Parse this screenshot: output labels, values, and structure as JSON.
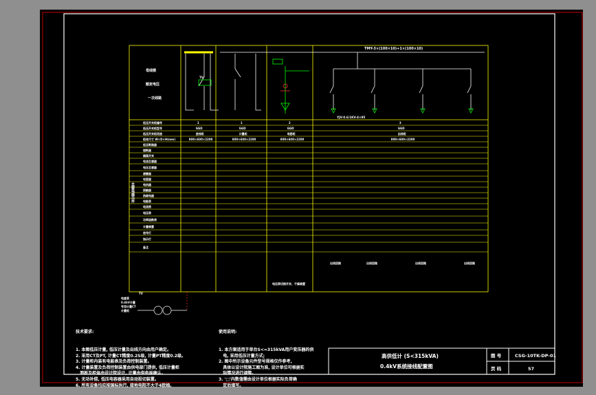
{
  "colors": {
    "frame": "#ffffff",
    "outer_frame": "#c00000",
    "grid": "#ffff00",
    "red": "#ff3030",
    "green": "#00ff00",
    "cyan": "#00ffff",
    "wire": "#ffffff"
  },
  "drawing": {
    "left_header": {
      "l1": "母线侧",
      "l2": "额定电压",
      "l3": "一次线路"
    },
    "busbar_label": "TMY-3×(100×10)+1×(100×10)",
    "feeder_cable": "YJV-0.6/1KV-4×95",
    "meter_labels": [
      "计量装置"
    ],
    "rows": [
      "低压开关柜编号",
      "低压开关柜型号",
      "低压开关柜用途",
      "柜体尺寸 W×D×H(mm)",
      "低压断路器",
      "熔断器",
      "隔离开关",
      "电流互感器",
      "电压互感器",
      "避雷器",
      "电容器",
      "电抗器",
      "接触器",
      "热继电器",
      "电能表",
      "电流表",
      "电压表",
      "功率因数表",
      "计量装置",
      "信号灯",
      "指示灯",
      "备注"
    ],
    "row_header_side": "主要电器元件",
    "panel_nos": [
      "1",
      "1",
      "2",
      "3"
    ],
    "panel_types": [
      "GGD",
      "GGD",
      "GGD",
      "GGD"
    ],
    "panel_uses": [
      "进线柜",
      "计量柜",
      "电容柜",
      "出线柜"
    ],
    "sizes": [
      "800×600×2200",
      "800×600×2200",
      "800×600×2200",
      "800×600×2200"
    ],
    "bottom_cells": [
      "电缆敷设方式",
      "YJV-0.6/1KV",
      "出线回路编号",
      "安装容量(kW)",
      "备注"
    ],
    "bottom_values": [
      "n1",
      "n2",
      "n3",
      "n4"
    ],
    "bottom_red": [
      "出线回路",
      "出线回路",
      "出线回路",
      "出线回路"
    ],
    "footer_notes": [
      "电压表切换开关、干燥装置"
    ]
  },
  "notes_left": {
    "heading": "技术要求:",
    "lines": [
      "1. 本图低压计量, 低压计量及出线方向由用户确定。",
      "2. 采用CT及PT, 计量CT精度0.2S级, 计量PT精度0.2级。",
      "3. 计量柜内装有电能表及负荷控制装置。",
      "4. 计量装置及负荷控制装置由供电部门提供, 低压计量柜",
      "   面板及柜体由设计院设计, 计量由供电局确认。",
      "5. 无功补偿, 低压电容器采用自动投切装置。",
      "6. 所有设备均应按国标执行, 接地电阻不大于4欧姆。"
    ]
  },
  "notes_right": {
    "heading": "使用说明:",
    "lines": [
      "1. 本方案适用于单台S<=315kVA用户变压器的供",
      "   电, 采用低压计量方式;",
      "2. 图中所示设备元件型号规格仅作参考,",
      "   具体以设计院施工图为准, 设计单位可根据实",
      "   际情况进行调整。",
      "3. '□'内数值需由设计单位根据实际负荷确",
      "   定后填写。"
    ]
  },
  "title_block": {
    "title_line1": "高供低计 (S<315kVA)",
    "title_line2": "0.4kV系统接线配置图",
    "label_drawing_no": "图 号",
    "drawing_no": "CSG-10TK-DP-01",
    "label_page": "页 码",
    "page_no": "57"
  },
  "meter_small": {
    "l1": "TV",
    "l2": "电度表",
    "l3": "0.4kV计量",
    "l4": "专用计量CT",
    "l5": "计量柜"
  }
}
